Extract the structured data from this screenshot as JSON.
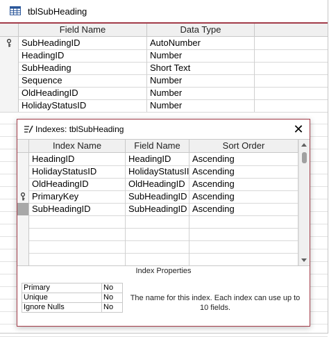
{
  "design": {
    "title": "tblSubHeading",
    "columns": [
      "Field Name",
      "Data Type"
    ],
    "fields": [
      {
        "name": "SubHeadingID",
        "type": "AutoNumber",
        "key": true
      },
      {
        "name": "HeadingID",
        "type": "Number",
        "key": false
      },
      {
        "name": "SubHeading",
        "type": "Short Text",
        "key": false
      },
      {
        "name": "Sequence",
        "type": "Number",
        "key": false
      },
      {
        "name": "OldHeadingID",
        "type": "Number",
        "key": false
      },
      {
        "name": "HolidayStatusID",
        "type": "Number",
        "key": false
      }
    ]
  },
  "indexes": {
    "title": "Indexes: tblSubHeading",
    "close_glyph": "✕",
    "columns": [
      "Index Name",
      "Field Name",
      "Sort Order"
    ],
    "rows": [
      {
        "index": "HeadingID",
        "field": "HeadingID",
        "sort": "Ascending",
        "key": false,
        "current": false
      },
      {
        "index": "HolidayStatusID",
        "field": "HolidayStatusII",
        "sort": "Ascending",
        "key": false,
        "current": false
      },
      {
        "index": "OldHeadingID",
        "field": "OldHeadingID",
        "sort": "Ascending",
        "key": false,
        "current": false
      },
      {
        "index": "PrimaryKey",
        "field": "SubHeadingID",
        "sort": "Ascending",
        "key": true,
        "current": false
      },
      {
        "index": "SubHeadingID",
        "field": "SubHeadingID",
        "sort": "Ascending",
        "key": false,
        "current": true
      }
    ],
    "properties_title": "Index Properties",
    "properties": [
      {
        "label": "Primary",
        "value": "No"
      },
      {
        "label": "Unique",
        "value": "No"
      },
      {
        "label": "Ignore Nulls",
        "value": "No"
      }
    ],
    "help_text": "The name for this index.  Each index can use up to 10 fields."
  },
  "colors": {
    "accent": "#a23b48"
  }
}
